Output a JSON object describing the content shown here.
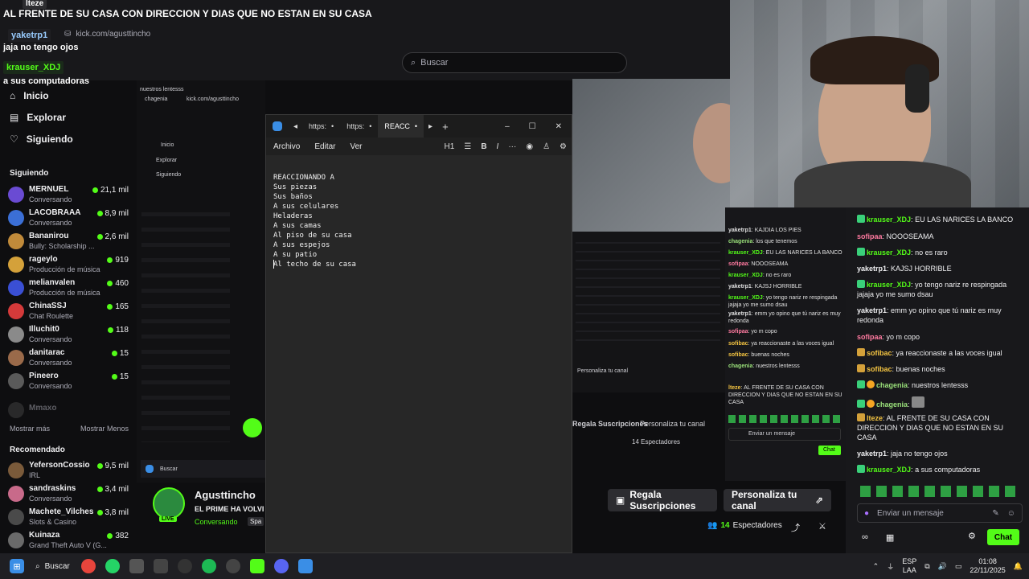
{
  "overlay": {
    "title": "AL FRENTE DE SU CASA CON DIRECCION Y DIAS QUE NO ESTAN EN SU CASA",
    "top_user": "lteze",
    "url": "kick.com/agusttincho",
    "chat_lines": [
      {
        "user": "yaketrp1",
        "text": "jaja no tengo ojos"
      },
      {
        "user": "krauser_XDJ",
        "text": "a sus computadoras"
      }
    ]
  },
  "search": {
    "placeholder": "Buscar"
  },
  "sidebar": {
    "nav": [
      {
        "label": "Inicio",
        "icon": "home-icon"
      },
      {
        "label": "Explorar",
        "icon": "compass-icon"
      },
      {
        "label": "Siguiendo",
        "icon": "heart-icon"
      }
    ],
    "following_title": "Siguiendo",
    "following": [
      {
        "name": "MERNUEL",
        "category": "Conversando",
        "viewers": "21,1 mil",
        "color": "#6a4bd3"
      },
      {
        "name": "LACOBRAAA",
        "category": "Conversando",
        "viewers": "8,9 mil",
        "color": "#3b6fd6"
      },
      {
        "name": "Bananirou",
        "category": "Bully: Scholarship ...",
        "viewers": "2,6 mil",
        "color": "#c08a3a"
      },
      {
        "name": "rageylo",
        "category": "Producción de música",
        "viewers": "919",
        "color": "#d4a13a"
      },
      {
        "name": "melianvalen",
        "category": "Producción de música",
        "viewers": "460",
        "color": "#3a4fd4"
      },
      {
        "name": "ChinaSSJ",
        "category": "Chat Roulette",
        "viewers": "165",
        "color": "#d43a3a"
      },
      {
        "name": "Illuchit0",
        "category": "Conversando",
        "viewers": "118",
        "color": "#8a8a8a"
      },
      {
        "name": "danitarac",
        "category": "Conversando",
        "viewers": "15",
        "color": "#9a6a4a"
      },
      {
        "name": "Pineero",
        "category": "Conversando",
        "viewers": "15",
        "color": "#5a5a5a"
      },
      {
        "name": "Mmaxo",
        "category": "",
        "viewers": "",
        "color": "#444"
      }
    ],
    "show_more": "Mostrar más",
    "show_less": "Mostrar Menos",
    "recommended_title": "Recomendado",
    "recommended": [
      {
        "name": "YefersonCossio",
        "category": "IRL",
        "viewers": "9,5 mil",
        "color": "#7a5a3a"
      },
      {
        "name": "sandraskins",
        "category": "Conversando",
        "viewers": "3,4 mil",
        "color": "#c86a8a"
      },
      {
        "name": "Machete_Vilches",
        "category": "Slots & Casino",
        "viewers": "3,8 mil",
        "color": "#4a4a4a"
      },
      {
        "name": "Kuinaza",
        "category": "Grand Theft Auto V (G...",
        "viewers": "382",
        "color": "#6a6a6a"
      }
    ]
  },
  "notepad": {
    "tabs": [
      "https:",
      "https:",
      "REACC"
    ],
    "menu": [
      "Archivo",
      "Editar",
      "Ver"
    ],
    "heading": "H1",
    "lines": [
      "REACCIONANDO A",
      "Sus piezas",
      "Sus baños",
      "A sus celulares",
      "Heladeras",
      "A sus camas",
      "Al piso de su casa",
      "A sus espejos",
      "A su patio",
      "Al techo de su casa"
    ]
  },
  "chat": {
    "messages": [
      {
        "user": "krauser_XDJ",
        "text": "EU LAS NARICES LA BANCO",
        "color": "#53fc18",
        "badge": "#3ad07a"
      },
      {
        "user": "sofipaa",
        "text": "NOOOSEAMA",
        "color": "#ff7aa0",
        "badge": ""
      },
      {
        "user": "krauser_XDJ",
        "text": "no es raro",
        "color": "#53fc18",
        "badge": "#3ad07a"
      },
      {
        "user": "yaketrp1",
        "text": "KAJSJ HORRIBLE",
        "color": "#efeff1",
        "badge": ""
      },
      {
        "user": "krauser_XDJ",
        "text": "yo tengo nariz re respingada jajaja yo me sumo dsau",
        "color": "#53fc18",
        "badge": "#3ad07a"
      },
      {
        "user": "yaketrp1",
        "text": "emm yo opino que tú nariz es muy redonda",
        "color": "#efeff1",
        "badge": ""
      },
      {
        "user": "sofipaa",
        "text": "yo m copo",
        "color": "#ff7aa0",
        "badge": ""
      },
      {
        "user": "sofibac",
        "text": "ya reaccionaste a las voces igual",
        "color": "#f5c542",
        "badge": "#d4a13a"
      },
      {
        "user": "sofibac",
        "text": "buenas noches",
        "color": "#f5c542",
        "badge": "#d4a13a"
      },
      {
        "user": "chagenia",
        "text": "nuestros lentesss",
        "color": "#9ae07a",
        "badge": "#3ad07a"
      },
      {
        "user": "chagenia",
        "text": "",
        "color": "#9ae07a",
        "badge": "#3ad07a"
      },
      {
        "user": "lteze",
        "text": "AL FRENTE DE SU CASA CON DIRECCION Y DIAS QUE NO ESTAN EN SU CASA",
        "color": "#f5c542",
        "badge": "#d4a13a"
      },
      {
        "user": "yaketrp1",
        "text": "jaja no tengo ojos",
        "color": "#efeff1",
        "badge": ""
      },
      {
        "user": "krauser_XDJ",
        "text": "a sus computadoras",
        "color": "#53fc18",
        "badge": "#3ad07a"
      }
    ],
    "input_placeholder": "Enviar un mensaje",
    "send_label": "Chat"
  },
  "mini_chat": [
    {
      "user": "yaketrp1",
      "text": "KAJDIA LOS PIES"
    },
    {
      "user": "chagenia",
      "text": "los que tenemos"
    },
    {
      "user": "krauser_XDJ",
      "text": "EU LAS NARICES LA BANCO"
    },
    {
      "user": "sofipaa",
      "text": "NOOOSEAMA"
    },
    {
      "user": "krauser_XDJ",
      "text": "no es raro"
    },
    {
      "user": "yaketrp1",
      "text": "KAJSJ HORRIBLE"
    },
    {
      "user": "krauser_XDJ",
      "text": "yo tengo nariz re respingada jajaja yo me sumo dsau"
    },
    {
      "user": "yaketrp1",
      "text": "emm yo opino que tú nariz es muy redonda"
    },
    {
      "user": "sofipaa",
      "text": "yo m copo"
    },
    {
      "user": "sofibac",
      "text": "ya reaccionaste a las voces igual"
    },
    {
      "user": "sofibac",
      "text": "buenas noches"
    },
    {
      "user": "chagenia",
      "text": "nuestros lentesss"
    },
    {
      "user": "lteze",
      "text": "AL FRENTE DE SU CASA CON DIRECCION Y DIAS QUE NO ESTAN EN SU CASA"
    }
  ],
  "stream": {
    "name": "Agusttincho",
    "title": "EL PRIME HA VOLVI",
    "category": "Conversando",
    "tag": "Spa",
    "live_label": "LIVE",
    "gift_label": "Regala Suscripciones",
    "customize_label": "Personaliza tu canal",
    "viewers_count": "14",
    "viewers_label": "Espectadores",
    "mid_gift": "Regala Suscripciones",
    "mid_customize": "Personaliza tu canal",
    "mid_viewers": "14 Espectadores"
  },
  "taskbar": {
    "search_label": "Buscar",
    "lang": "ESP",
    "lang2": "LAA",
    "time": "01:08",
    "date": "22/11/2025"
  },
  "mirror": {
    "inicio": "Inicio",
    "explorar": "Explorar",
    "siguiendo": "Siguiendo",
    "url": "kick.com/agusttincho",
    "user": "chagenia",
    "lentes": "nuestros lentesss",
    "search": "Buscar"
  }
}
